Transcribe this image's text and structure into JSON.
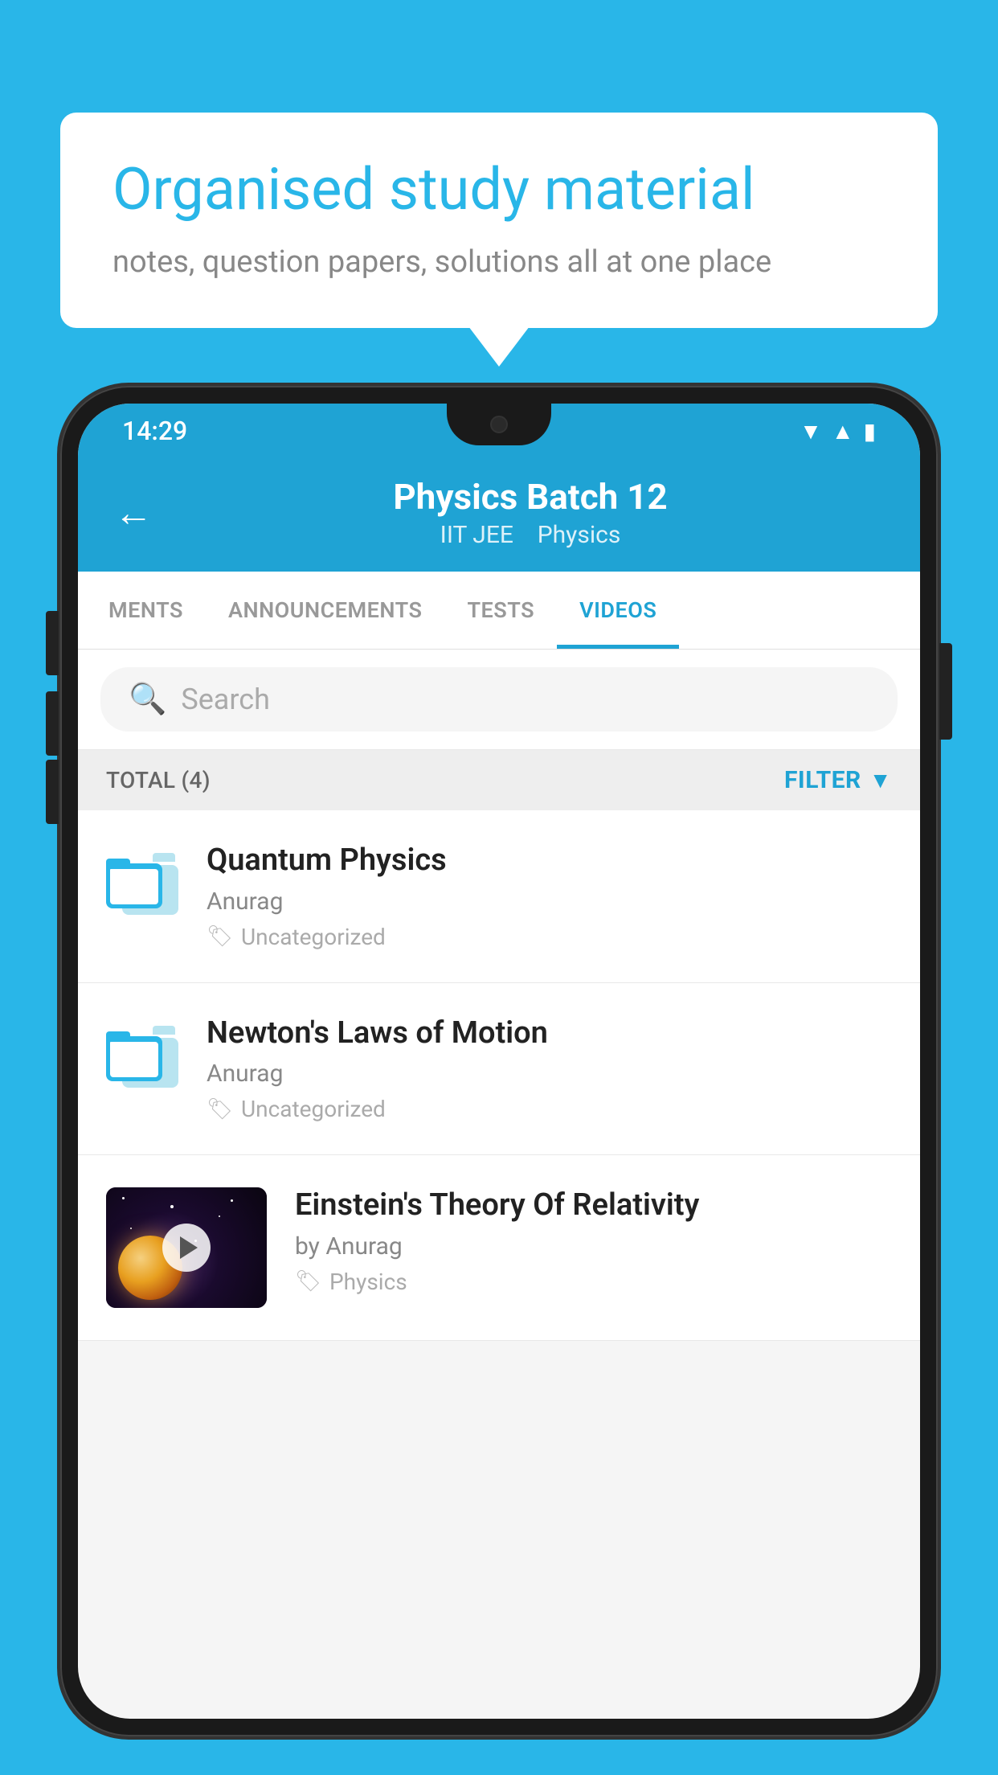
{
  "background_color": "#29b6e8",
  "speech_bubble": {
    "title": "Organised study material",
    "subtitle": "notes, question papers, solutions all at one place"
  },
  "status_bar": {
    "time": "14:29",
    "wifi": "▼",
    "signal": "▲",
    "battery": "▮"
  },
  "app_header": {
    "back_label": "←",
    "title": "Physics Batch 12",
    "subtitle_1": "IIT JEE",
    "subtitle_2": "Physics"
  },
  "tabs": [
    {
      "label": "MENTS",
      "active": false
    },
    {
      "label": "ANNOUNCEMENTS",
      "active": false
    },
    {
      "label": "TESTS",
      "active": false
    },
    {
      "label": "VIDEOS",
      "active": true
    }
  ],
  "search": {
    "placeholder": "Search"
  },
  "filter_row": {
    "total_label": "TOTAL (4)",
    "filter_label": "FILTER"
  },
  "list_items": [
    {
      "title": "Quantum Physics",
      "author": "Anurag",
      "tag": "Uncategorized",
      "type": "folder"
    },
    {
      "title": "Newton's Laws of Motion",
      "author": "Anurag",
      "tag": "Uncategorized",
      "type": "folder"
    },
    {
      "title": "Einstein's Theory Of Relativity",
      "author": "by Anurag",
      "tag": "Physics",
      "type": "video"
    }
  ],
  "icons": {
    "search": "🔍",
    "tag": "🏷",
    "back": "←",
    "filter_funnel": "▼"
  }
}
